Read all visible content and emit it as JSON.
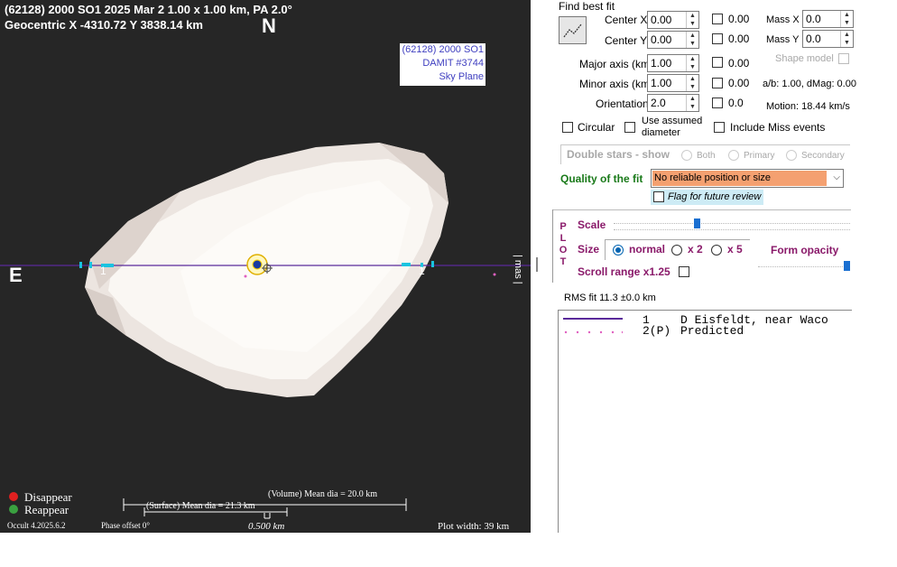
{
  "plot": {
    "header_line1": "(62128) 2000 SO1  2025 Mar 2  1.00 x 1.00 km, PA 2.0°",
    "header_line2": "Geocentric X -4310.72  Y 3838.14 km",
    "north": "N",
    "east": "E",
    "legend_box": [
      "(62128) 2000 SO1",
      "DAMIT #3744",
      "Sky Plane"
    ],
    "chord_label_left": "1",
    "chord_label_right": "1",
    "mas_label": "| mas |",
    "disappear": "Disappear",
    "reappear": "Reappear",
    "disappear_color": "#e02020",
    "reappear_color": "#3aa040",
    "volume_dia": "(Volume) Mean dia = 20.0 km",
    "surface_dia": "(Surface) Mean dia = 21.3 km",
    "scale_len": "0.500 km",
    "version": "Occult 4.2025.6.2",
    "phase_offset": "Phase offset 0°",
    "plot_width": "Plot width: 39 km",
    "chord_color": "#5a2a9a",
    "shape_color": "#f4ede8"
  },
  "panel": {
    "find_best_fit": "Find best fit",
    "center_x_label": "Center X",
    "center_x": "0.00",
    "center_x_fixed": "0.00",
    "center_y_label": "Center Y",
    "center_y": "0.00",
    "center_y_fixed": "0.00",
    "mass_x_label": "Mass X",
    "mass_x": "0.0",
    "mass_y_label": "Mass Y",
    "mass_y": "0.0",
    "major_label": "Major axis (km)",
    "major": "1.00",
    "major_fixed": "0.00",
    "minor_label": "Minor axis (km)",
    "minor": "1.00",
    "minor_fixed": "0.00",
    "orient_label": "Orientation",
    "orient": "2.0",
    "orient_fixed": "0.0",
    "shape_model": "Shape model",
    "ab_text": "a/b: 1.00, dMag: 0.00",
    "motion": "Motion: 18.44 km/s",
    "circular": "Circular",
    "use_assumed": "Use assumed",
    "diameter": "diameter",
    "include_miss": "Include Miss events",
    "double_stars": "Double stars - show",
    "both": "Both",
    "primary": "Primary",
    "secondary": "Secondary",
    "quality_label": "Quality of the fit",
    "quality_value": "No reliable position or size",
    "quality_color": "#f4a070",
    "flag_label": "Flag for future review",
    "plot_vertical": [
      "P",
      "L",
      "O",
      "T"
    ],
    "scale": "Scale",
    "scale_level": 0.35,
    "size": "Size",
    "size_normal": "normal",
    "size_x2": "x 2",
    "size_x5": "x 5",
    "form_opacity": "Form opacity",
    "opacity_level": 1.0,
    "scroll_range": "Scroll range x1.25",
    "rms": "RMS fit 11.3 ±0.0 km",
    "observers": [
      {
        "num": "1",
        "name": "D Eisfeldt, near Waco"
      },
      {
        "num": "2(P)",
        "name": "Predicted"
      }
    ]
  }
}
